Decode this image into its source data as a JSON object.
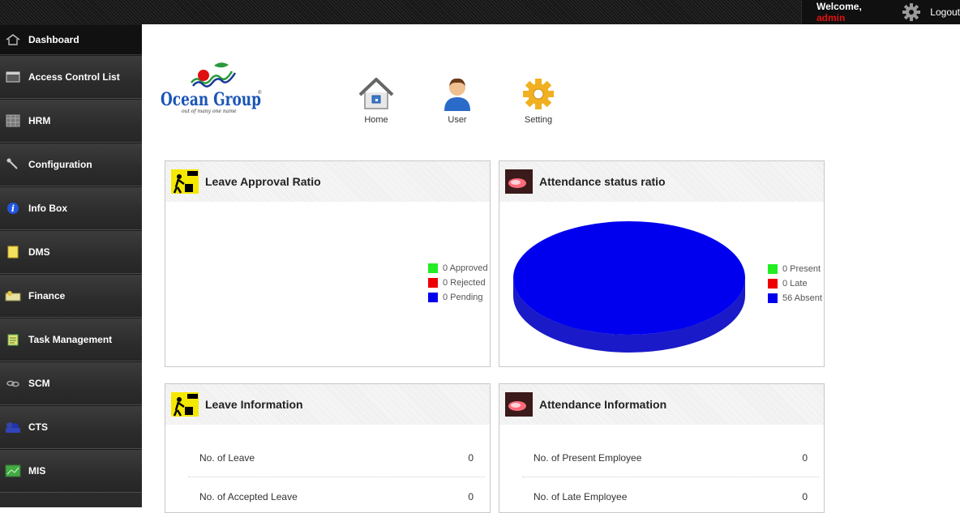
{
  "topbar": {
    "welcome_label": "Welcome,",
    "username": "admin",
    "logout_label": "Logout"
  },
  "sidebar": {
    "items": [
      {
        "label": "Dashboard",
        "icon": "home-icon"
      },
      {
        "label": "Access Control List",
        "icon": "window-icon"
      },
      {
        "label": "HRM",
        "icon": "grid-icon"
      },
      {
        "label": "Configuration",
        "icon": "wrench-icon"
      },
      {
        "label": "Info Box",
        "icon": "info-icon"
      },
      {
        "label": "DMS",
        "icon": "document-icon"
      },
      {
        "label": "Finance",
        "icon": "money-icon"
      },
      {
        "label": "Task Management",
        "icon": "clipboard-icon"
      },
      {
        "label": "SCM",
        "icon": "chain-icon"
      },
      {
        "label": "CTS",
        "icon": "group-icon"
      },
      {
        "label": "MIS",
        "icon": "chart-icon"
      }
    ]
  },
  "header": {
    "logo_text": "Ocean Group",
    "logo_tagline": "out of many one name",
    "quick_links": [
      {
        "label": "Home",
        "icon": "house-icon"
      },
      {
        "label": "User",
        "icon": "user-icon"
      },
      {
        "label": "Setting",
        "icon": "gear-icon"
      }
    ]
  },
  "panels": {
    "leave_ratio": {
      "title": "Leave Approval Ratio",
      "legend": [
        {
          "label": "0 Approved",
          "color": "#22ee22"
        },
        {
          "label": "0 Rejected",
          "color": "#ee0000"
        },
        {
          "label": "0 Pending",
          "color": "#0000ee"
        }
      ]
    },
    "attendance_ratio": {
      "title": "Attendance status ratio",
      "legend": [
        {
          "label": "0 Present",
          "color": "#22ee22"
        },
        {
          "label": "0 Late",
          "color": "#ee0000"
        },
        {
          "label": "56 Absent",
          "color": "#0000ee"
        }
      ]
    },
    "leave_info": {
      "title": "Leave Information",
      "rows": [
        {
          "label": "No. of Leave",
          "value": "0"
        },
        {
          "label": "No. of Accepted Leave",
          "value": "0"
        }
      ]
    },
    "attendance_info": {
      "title": "Attendance Information",
      "rows": [
        {
          "label": "No. of Present Employee",
          "value": "0"
        },
        {
          "label": "No. of Late Employee",
          "value": "0"
        }
      ]
    }
  },
  "chart_data": [
    {
      "type": "pie",
      "categories": [
        "Approved",
        "Rejected",
        "Pending"
      ],
      "values": [
        0,
        0,
        0
      ],
      "colors": [
        "#22ee22",
        "#ee0000",
        "#0000ee"
      ],
      "legend": "right"
    },
    {
      "type": "pie",
      "categories": [
        "Present",
        "Late",
        "Absent"
      ],
      "values": [
        0,
        0,
        56
      ],
      "colors": [
        "#22ee22",
        "#ee0000",
        "#0000ee"
      ],
      "legend": "right"
    }
  ]
}
